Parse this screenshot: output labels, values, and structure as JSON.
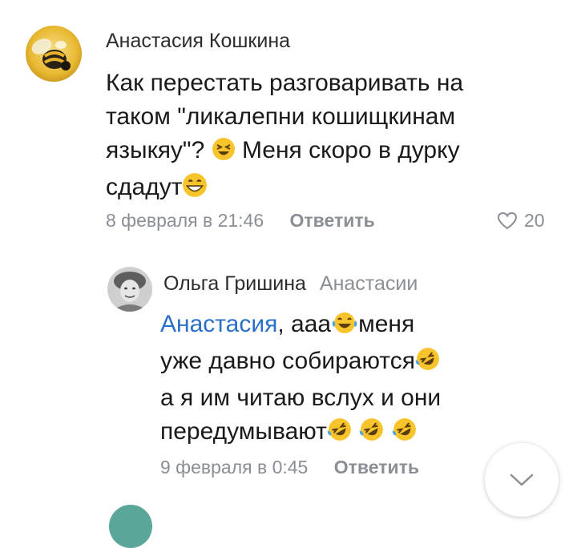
{
  "comments": [
    {
      "author": "Анастасия Кошкина",
      "lines": [
        {
          "before": "Как перестать разговаривать на"
        },
        {
          "before": "таком \"ликалепни кошищкинам"
        },
        {
          "before": "языкяу\"?",
          "after": "Меня скоро в дурку"
        },
        {
          "before": "сдадут"
        }
      ],
      "date": "8 февраля в 21:46",
      "reply_label": "Ответить",
      "likes": "20"
    },
    {
      "author": "Ольга Гришина",
      "reply_to": "Анастасии",
      "mention": "Анастасия",
      "lines": [
        {
          "before": ", ааа",
          "after": "меня"
        },
        {
          "before": "уже давно собираются"
        },
        {
          "before": "а я им читаю вслух и они"
        },
        {
          "before": "передумывают"
        }
      ],
      "date": "9 февраля в 0:45",
      "reply_label": "Ответить"
    }
  ],
  "icons": {
    "like": "heart-outline-icon",
    "scroll": "chevron-down-icon"
  },
  "colors": {
    "mention": "#2a6fc9",
    "meta": "#8a8f96",
    "emoji": "#f7c52b"
  }
}
